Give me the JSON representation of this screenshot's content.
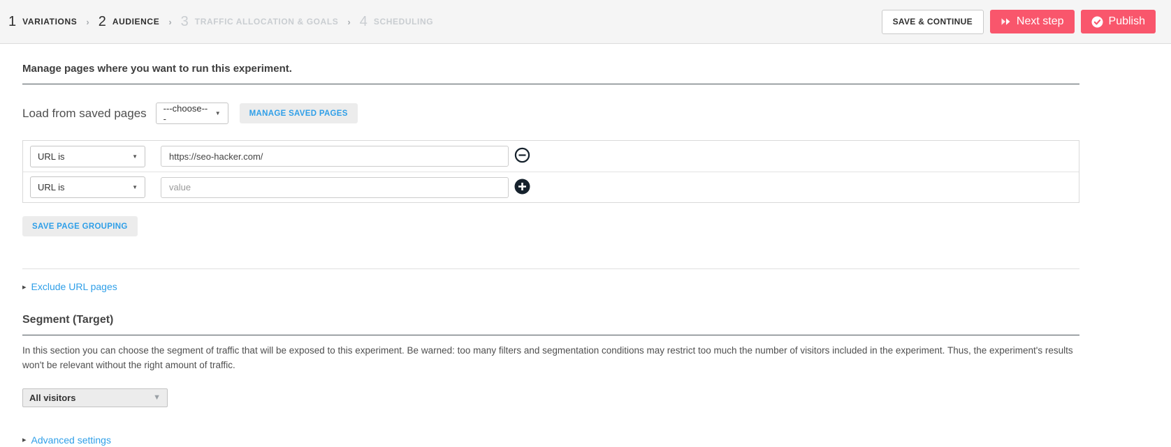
{
  "header": {
    "separator": "›",
    "steps": [
      {
        "number": "1",
        "label": "VARIATIONS"
      },
      {
        "number": "2",
        "label": "AUDIENCE"
      },
      {
        "number": "3",
        "label": "TRAFFIC ALLOCATION & GOALS"
      },
      {
        "number": "4",
        "label": "SCHEDULING"
      }
    ],
    "buttons": {
      "save_continue": "SAVE & CONTINUE",
      "next_step": "Next step",
      "publish": "Publish"
    }
  },
  "page": {
    "intro": "Manage pages where you want to run this experiment.",
    "load_label": "Load from saved pages",
    "choose_value": "---choose---",
    "select_arrow": "▼",
    "manage_saved_pages": "MANAGE SAVED PAGES",
    "url_rows": [
      {
        "condition": "URL is",
        "value": "https://seo-hacker.com/",
        "placeholder": ""
      },
      {
        "condition": "URL is",
        "value": "",
        "placeholder": "value"
      }
    ],
    "save_page_grouping": "SAVE PAGE GROUPING",
    "toggle_caret": "▸",
    "exclude_link": "Exclude URL pages",
    "segment_heading": "Segment (Target)",
    "segment_description": "In this section you can choose the segment of traffic that will be exposed to this experiment. Be warned: too many filters and segmentation conditions may restrict too much the number of visitors included in the experiment. Thus, the experiment's results won't be relevant without the right amount of traffic.",
    "visitors_value": "All visitors",
    "advanced_link": "Advanced settings"
  },
  "colors": {
    "accent_pink": "#f9566c",
    "link_blue": "#2f9fe8",
    "dark_icon": "#16222d",
    "heading_underline": "#4d565c"
  }
}
